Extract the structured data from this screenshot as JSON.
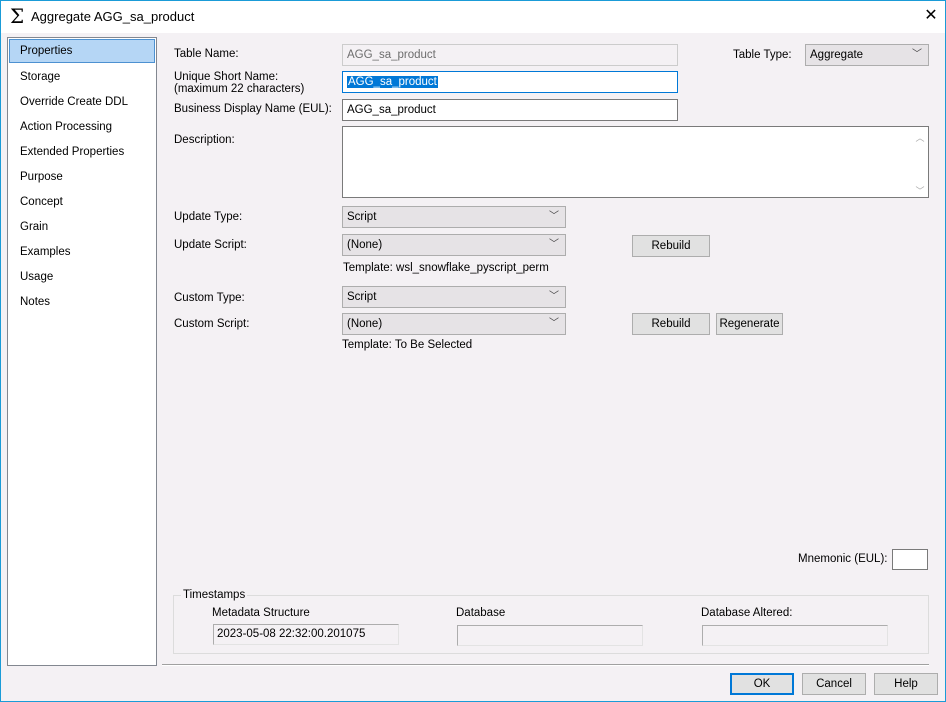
{
  "window": {
    "title": "Aggregate AGG_sa_product"
  },
  "sidebar": {
    "items": [
      {
        "label": "Properties"
      },
      {
        "label": "Storage"
      },
      {
        "label": "Override Create DDL"
      },
      {
        "label": "Action Processing"
      },
      {
        "label": "Extended Properties"
      },
      {
        "label": "Purpose"
      },
      {
        "label": "Concept"
      },
      {
        "label": "Grain"
      },
      {
        "label": "Examples"
      },
      {
        "label": "Usage"
      },
      {
        "label": "Notes"
      }
    ]
  },
  "form": {
    "table_name_label": "Table Name:",
    "table_name": "AGG_sa_product",
    "unique_label_1": "Unique Short Name:",
    "unique_label_2": "(maximum 22 characters)",
    "unique_short_name": "AGG_sa_product",
    "business_label": "Business Display Name (EUL):",
    "business_name": "AGG_sa_product",
    "table_type_label": "Table Type:",
    "table_type": "Aggregate",
    "description_label": "Description:",
    "description": "",
    "update_type_label": "Update Type:",
    "update_type": "Script",
    "update_script_label": "Update Script:",
    "update_script": "(None)",
    "update_template": "Template: wsl_snowflake_pyscript_perm",
    "custom_type_label": "Custom Type:",
    "custom_type": "Script",
    "custom_script_label": "Custom Script:",
    "custom_script": "(None)",
    "custom_template": "Template: To Be Selected",
    "rebuild": "Rebuild",
    "regenerate": "Regenerate",
    "mnemonic_label": "Mnemonic (EUL):",
    "mnemonic": ""
  },
  "timestamps": {
    "legend": "Timestamps",
    "metadata_label": "Metadata Structure",
    "metadata": "2023-05-08 22:32:00.201075",
    "database_label": "Database",
    "database": "",
    "altered_label": "Database Altered:",
    "altered": ""
  },
  "footer": {
    "ok": "OK",
    "cancel": "Cancel",
    "help": "Help"
  }
}
